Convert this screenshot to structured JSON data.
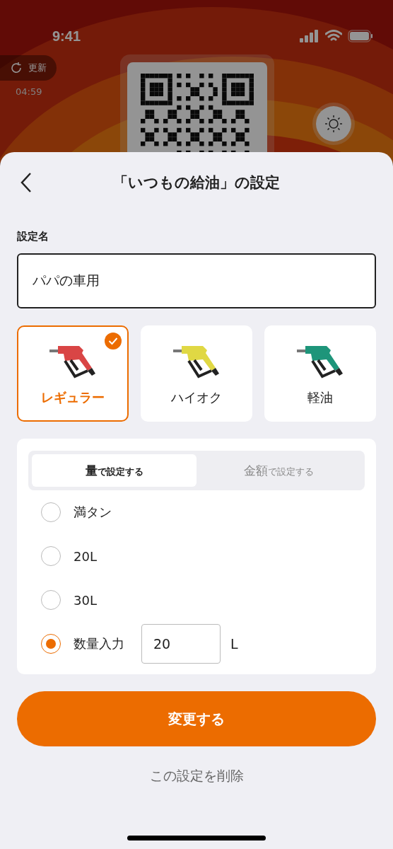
{
  "background": {
    "status_bar": {
      "time": "9:41"
    },
    "refresh_button": "更新",
    "timer": "04:59"
  },
  "sheet": {
    "title": "「いつもの給油」の設定",
    "name_label": "設定名",
    "name_value": "パパの車用",
    "fuels": [
      {
        "label": "レギュラー",
        "color": "#d94545",
        "selected": true
      },
      {
        "label": "ハイオク",
        "color": "#e0d844",
        "selected": false
      },
      {
        "label": "軽油",
        "color": "#1e957a",
        "selected": false
      }
    ],
    "modes": [
      {
        "main": "量",
        "suffix": "で設定する",
        "selected": true
      },
      {
        "main": "金額",
        "suffix": "で設定する",
        "selected": false
      }
    ],
    "options": [
      {
        "kind": "plain",
        "label": "満タン",
        "selected": false
      },
      {
        "kind": "plain",
        "label": "20L",
        "selected": false
      },
      {
        "kind": "plain",
        "label": "30L",
        "selected": false
      },
      {
        "kind": "input",
        "label": "数量入力",
        "value": "20",
        "unit": "L",
        "selected": true
      }
    ],
    "submit": "変更する",
    "delete": "この設定を削除"
  }
}
